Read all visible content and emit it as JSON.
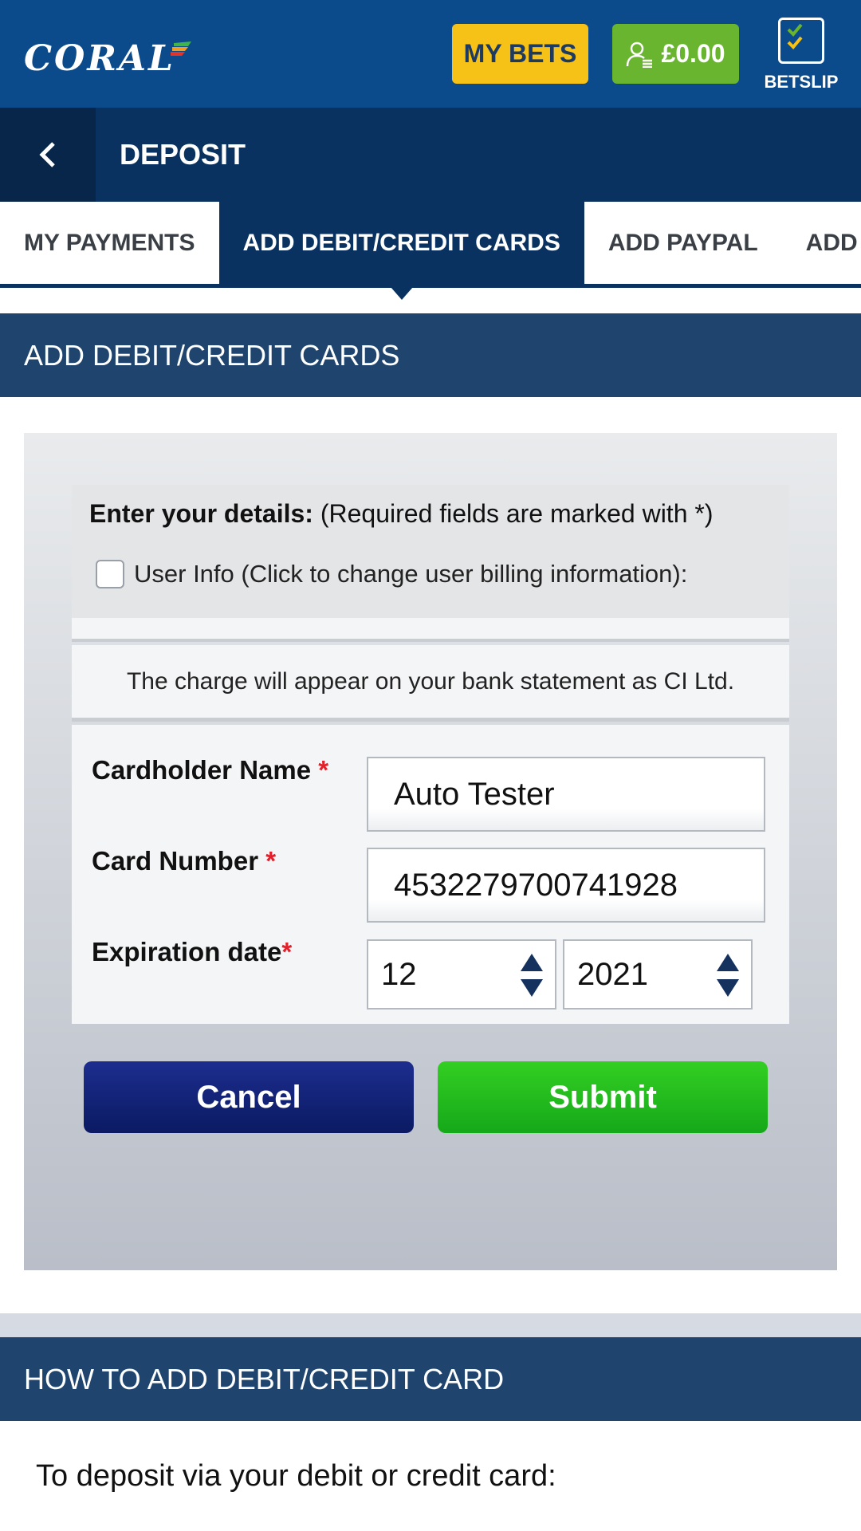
{
  "header": {
    "logo_text": "CORAL",
    "my_bets_label": "MY BETS",
    "balance": "£0.00",
    "betslip_label": "BETSLIP"
  },
  "subheader": {
    "title": "DEPOSIT"
  },
  "tabs": [
    {
      "label": "MY PAYMENTS",
      "active": false
    },
    {
      "label": "ADD DEBIT/CREDIT CARDS",
      "active": true
    },
    {
      "label": "ADD PAYPAL",
      "active": false
    },
    {
      "label": "ADD P",
      "active": false
    }
  ],
  "section": {
    "title": "ADD DEBIT/CREDIT CARDS"
  },
  "form": {
    "details_bold": "Enter your details:",
    "details_note": "(Required fields are marked with *)",
    "user_info_label": "User Info (Click to change user billing information):",
    "notice": "The charge will appear on your bank statement as CI Ltd.",
    "cardholder_label": "Cardholder Name",
    "cardholder_value": "Auto Tester",
    "card_number_label": "Card Number",
    "card_number_value": "4532279700741928",
    "expiration_label": "Expiration date",
    "exp_month": "12",
    "exp_year": "2021",
    "required_marker": "*",
    "cancel_label": "Cancel",
    "submit_label": "Submit"
  },
  "howto": {
    "title": "HOW TO ADD DEBIT/CREDIT CARD",
    "text": "To deposit via your debit or credit card:"
  },
  "colors": {
    "header_blue": "#0b4a8b",
    "subheader_navy": "#0a3260",
    "my_bets_yellow": "#f6c218",
    "balance_green": "#6ab52f",
    "submit_green": "#1fbf1d",
    "cancel_navy": "#13247a",
    "required_red": "#e0202a"
  },
  "icons": [
    "back-chevron-icon",
    "user-icon",
    "betslip-check-icon",
    "spinner-arrows-icon"
  ]
}
